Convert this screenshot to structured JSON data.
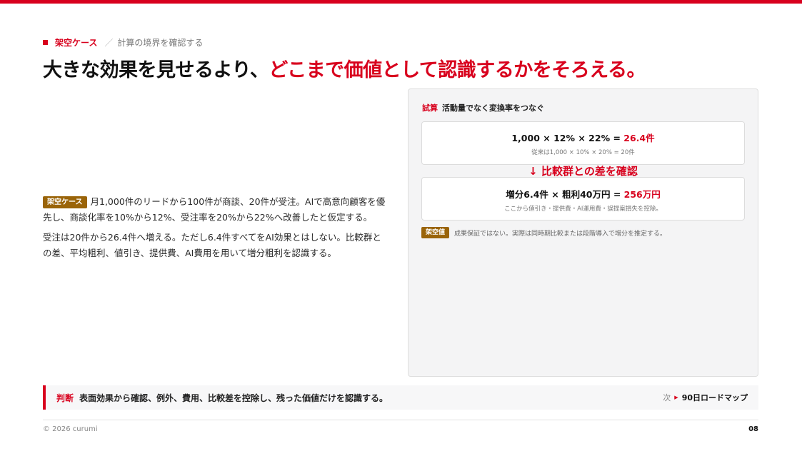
{
  "header": {
    "eyebrow_label": "架空ケース",
    "eyebrow_sep": "／",
    "eyebrow_sub": "計算の境界を確認する",
    "headline_main": "大きな効果を見せるより、",
    "headline_accent": "どこまで価値として認識するかをそろえる。"
  },
  "left": {
    "tag": "架空ケース",
    "para1": "月1,000件のリードから100件が商談、20件が受注。AIで高意向顧客を優先し、商談化率を10%から12%、受注率を20%から22%へ改善したと仮定する。",
    "para2": "受注は20件から26.4件へ増える。ただし6.4件すべてをAI効果とはしない。比較群との差、平均粗利、値引き、提供費、AI費用を用いて増分粗利を認識する。"
  },
  "panel": {
    "head_key": "試算",
    "head_text": "活動量でなく変換率をつなぐ",
    "box1_formula": "1,000 × 12% × 22% = ",
    "box1_result": "26.4件",
    "box1_note": "従来は1,000 × 10% × 20% = 20件",
    "arrow_text": "↓ 比較群との差を確認",
    "box2_formula": "増分6.4件 × 粗利40万円 = ",
    "box2_result": "256万円",
    "box2_note": "ここから値引き・提供費・AI運用費・誤提案損失を控除。",
    "note_tag": "架空値",
    "note_text": "成果保証ではない。実際は同時期比較または段階導入で増分を推定する。"
  },
  "judge": {
    "key": "判断",
    "text": "表面効果から確認、例外、費用、比較差を控除し、残った価値だけを認識する。",
    "next_label": "次",
    "next_dest": "90日ロードマップ"
  },
  "footer": {
    "copyright": "© 2026 curumi",
    "page": "08"
  },
  "colors": {
    "accent": "#d8001d",
    "tag": "#9a6409"
  }
}
